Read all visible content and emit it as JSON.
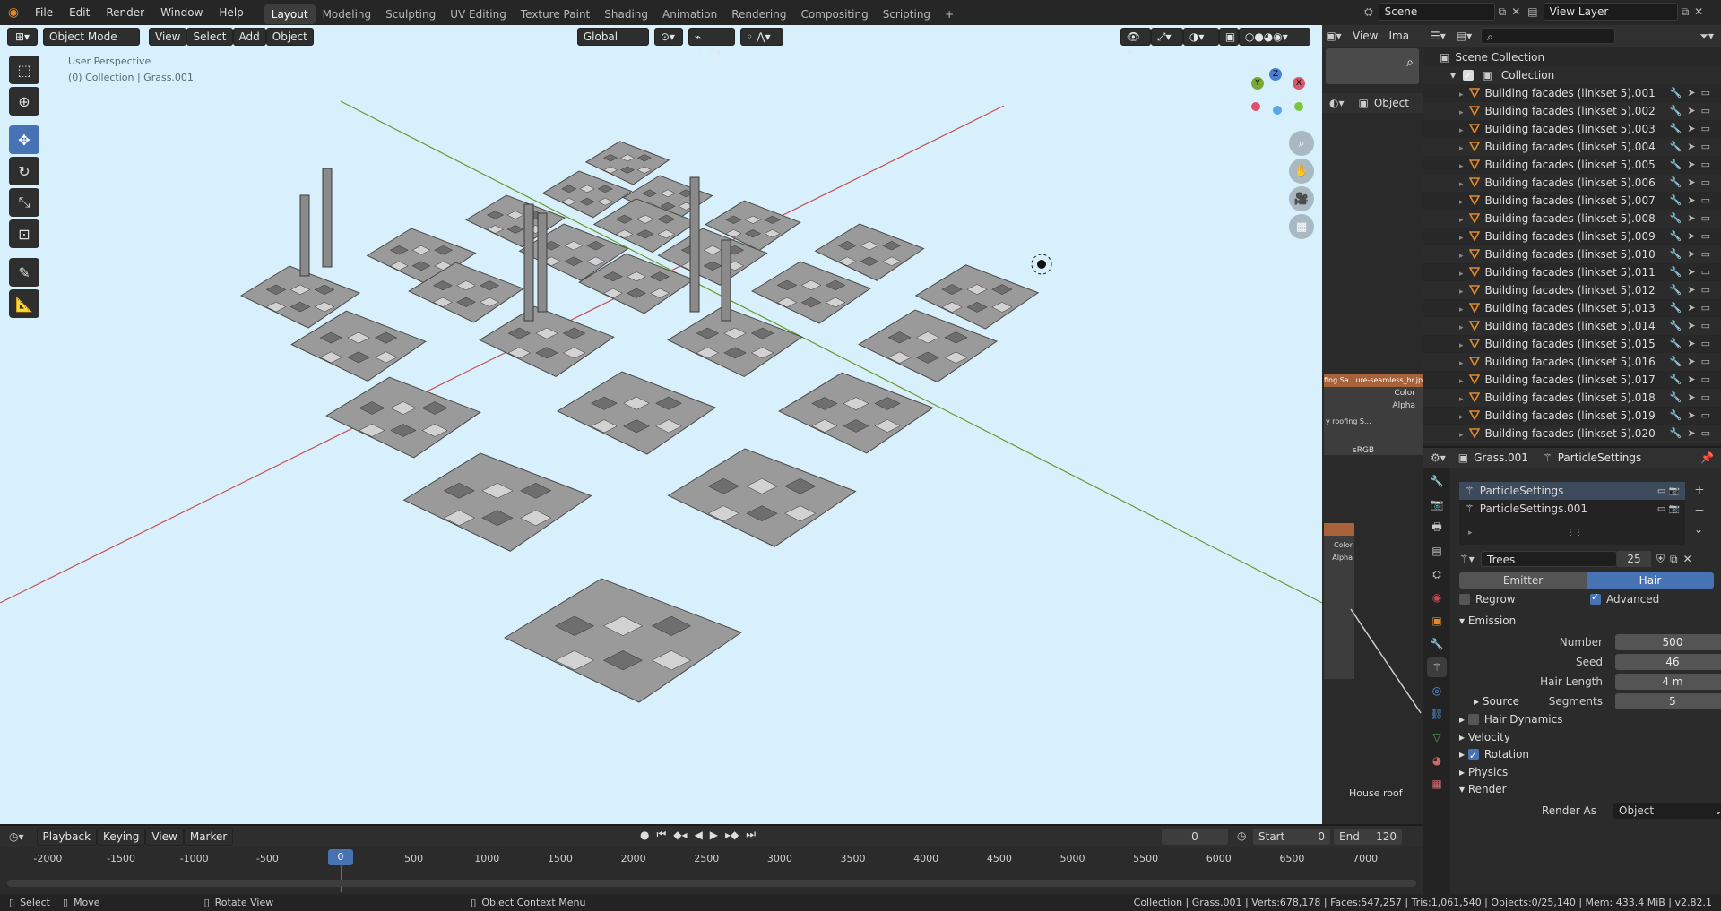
{
  "topbar": {
    "menus": [
      "File",
      "Edit",
      "Render",
      "Window",
      "Help"
    ],
    "workspaces": [
      "Layout",
      "Modeling",
      "Sculpting",
      "UV Editing",
      "Texture Paint",
      "Shading",
      "Animation",
      "Rendering",
      "Compositing",
      "Scripting"
    ],
    "active_workspace": "Layout",
    "add_workspace": "+",
    "scene": "Scene",
    "view_layer": "View Layer"
  },
  "viewport": {
    "mode": "Object Mode",
    "menus": [
      "View",
      "Select",
      "Add",
      "Object"
    ],
    "orientation": "Global",
    "perspective_label": "User Perspective",
    "collection_label": "(0) Collection | Grass.001",
    "gizmo": {
      "x": "X",
      "y": "Y",
      "z": "Z"
    },
    "background_color": "#d7f0fb",
    "x_axis_color": "#c8505a",
    "y_axis_color": "#6a9a2e"
  },
  "midstrip": {
    "menus": [
      "View",
      "Ima"
    ],
    "object_btn": "Object",
    "image_name": "fing Sa...ure-seamless_hr.jpg",
    "color_label": "Color",
    "alpha_label": "Alpha",
    "tex_name": "y roofing S...",
    "colorspace": "sRGB",
    "node_color": "Color",
    "node_alpha": "Alpha",
    "house_roof": "House roof"
  },
  "outliner": {
    "scene_collection": "Scene Collection",
    "collection": "Collection",
    "items": [
      "Building facades (linkset 5).001",
      "Building facades (linkset 5).002",
      "Building facades (linkset 5).003",
      "Building facades (linkset 5).004",
      "Building facades (linkset 5).005",
      "Building facades (linkset 5).006",
      "Building facades (linkset 5).007",
      "Building facades (linkset 5).008",
      "Building facades (linkset 5).009",
      "Building facades (linkset 5).010",
      "Building facades (linkset 5).011",
      "Building facades (linkset 5).012",
      "Building facades (linkset 5).013",
      "Building facades (linkset 5).014",
      "Building facades (linkset 5).015",
      "Building facades (linkset 5).016",
      "Building facades (linkset 5).017",
      "Building facades (linkset 5).018",
      "Building facades (linkset 5).019",
      "Building facades (linkset 5).020"
    ]
  },
  "properties": {
    "object": "Grass.001",
    "particle_settings": "ParticleSettings",
    "systems": [
      "ParticleSettings",
      "ParticleSettings.001"
    ],
    "settings_name": "Trees",
    "settings_users": "25",
    "type_tabs": [
      "Emitter",
      "Hair"
    ],
    "active_type": "Hair",
    "regrow": "Regrow",
    "advanced": "Advanced",
    "emission": {
      "title": "Emission",
      "fields": [
        {
          "label": "Number",
          "value": "500"
        },
        {
          "label": "Seed",
          "value": "46"
        },
        {
          "label": "Hair Length",
          "value": "4 m"
        },
        {
          "label": "Segments",
          "value": "5"
        }
      ]
    },
    "source": "Source",
    "hair_dynamics": "Hair Dynamics",
    "velocity": "Velocity",
    "rotation": "Rotation",
    "physics": "Physics",
    "render": "Render",
    "render_as_label": "Render As",
    "render_as_value": "Object"
  },
  "timeline": {
    "menus": [
      "Playback",
      "Keying",
      "View",
      "Marker"
    ],
    "current_frame": "0",
    "start_label": "Start",
    "start": "0",
    "end_label": "End",
    "end": "120",
    "ticks": [
      "-2000",
      "-1500",
      "-1000",
      "-500",
      "0",
      "500",
      "1000",
      "1500",
      "2000",
      "2500",
      "3000",
      "3500",
      "4000",
      "4500",
      "5000",
      "5500",
      "6000",
      "6500",
      "7000"
    ],
    "playhead": "0"
  },
  "statusbar": {
    "select": "Select",
    "move": "Move",
    "rotate": "Rotate View",
    "context": "Object Context Menu",
    "stats": "Collection | Grass.001 | Verts:678,178 | Faces:547,257 | Tris:1,061,540 | Objects:0/25,140 | Mem: 433.4 MiB | v2.82.1"
  }
}
